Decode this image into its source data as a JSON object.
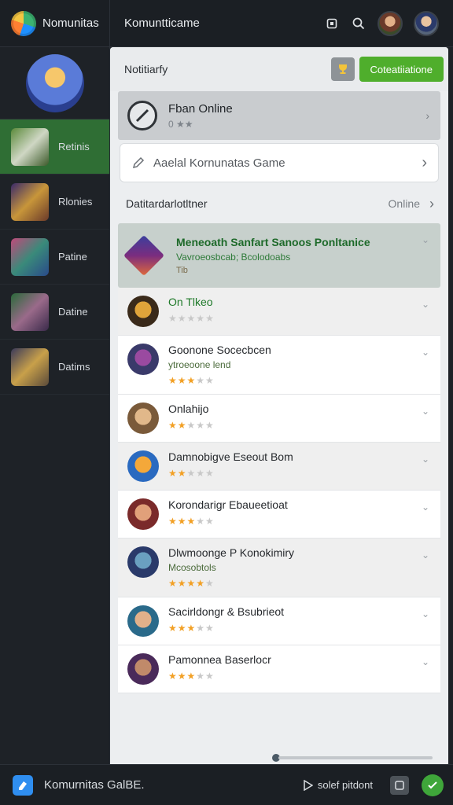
{
  "brand": {
    "name": "Nomunitas"
  },
  "topbar": {
    "title": "Komuntticame",
    "icons": [
      "window-icon",
      "search-icon"
    ]
  },
  "colors": {
    "accent_green": "#4fae2c",
    "sidebar_active": "#2f6e34",
    "bottom_blue": "#2f8ef0"
  },
  "sidebar": {
    "items": [
      {
        "label": "Retinis",
        "active": true
      },
      {
        "label": "Rlonies",
        "active": false
      },
      {
        "label": "Patine",
        "active": false
      },
      {
        "label": "Datine",
        "active": false
      },
      {
        "label": "Datims",
        "active": false
      }
    ]
  },
  "notifications": {
    "title": "Notitiarfy",
    "green_button": "Coteatiiatione"
  },
  "online_card": {
    "title": "Fban Online",
    "sub": "0 ★★"
  },
  "search": {
    "value": "Aaelal Kornunatas Game"
  },
  "status": {
    "label": "Datitardarlotltner",
    "value": "Online"
  },
  "feature": {
    "title": "Meneoath Sanfart Sanoos Ponltanice",
    "sub": "Vavroeosbcab; Bcolodoabs",
    "meta": "Tib"
  },
  "list": [
    {
      "title": "On Tlkeo",
      "sub": "",
      "rating": 0,
      "shade": true,
      "green": true
    },
    {
      "title": "Goonone Socecbcen",
      "sub": "ytroeoone lend",
      "rating": 3,
      "shade": false,
      "green": false
    },
    {
      "title": "Onlahijo",
      "sub": "",
      "rating": 2,
      "shade": false,
      "green": false
    },
    {
      "title": "Damnobigve Eseout Bom",
      "sub": "",
      "rating": 2,
      "shade": true,
      "green": false
    },
    {
      "title": "Korondarigr Ebaueetioat",
      "sub": "",
      "rating": 3,
      "shade": false,
      "green": false
    },
    {
      "title": "Dlwmoonge P Konokimiry",
      "sub": "Mcosobtols",
      "rating": 4,
      "shade": true,
      "green": false
    },
    {
      "title": "Sacirldongr & Bsubrieot",
      "sub": "",
      "rating": 3,
      "shade": false,
      "green": false
    },
    {
      "title": "Pamonnea Baserlocr",
      "sub": "",
      "rating": 3,
      "shade": false,
      "green": false
    }
  ],
  "bottombar": {
    "title": "Komurnitas GalBE.",
    "play_label": "solef pitdont"
  }
}
